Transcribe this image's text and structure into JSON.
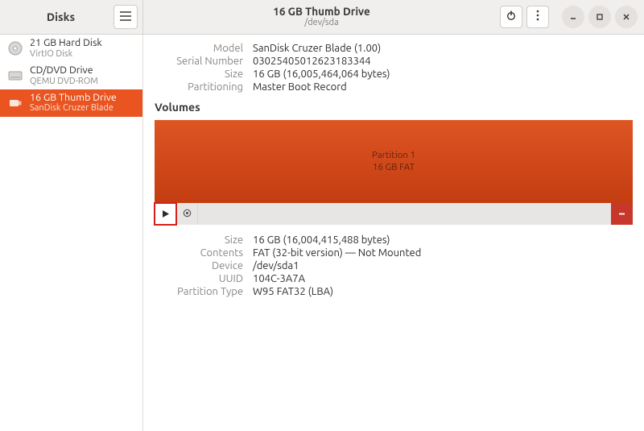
{
  "header": {
    "app_title": "Disks",
    "drive_title": "16 GB Thumb Drive",
    "drive_path": "/dev/sda"
  },
  "sidebar": {
    "drives": [
      {
        "name": "21 GB Hard Disk",
        "sub": "VirtIO Disk"
      },
      {
        "name": "CD/DVD Drive",
        "sub": "QEMU DVD-ROM"
      },
      {
        "name": "16 GB Thumb Drive",
        "sub": "SanDisk Cruzer Blade"
      }
    ]
  },
  "drive_info": {
    "labels": {
      "model": "Model",
      "serial": "Serial Number",
      "size": "Size",
      "partitioning": "Partitioning"
    },
    "model": "SanDisk Cruzer Blade (1.00)",
    "serial": "03025405012623183344",
    "size": "16 GB (16,005,464,064 bytes)",
    "partitioning": "Master Boot Record"
  },
  "volumes": {
    "section_title": "Volumes",
    "partition_title": "Partition 1",
    "partition_sub": "16 GB FAT"
  },
  "volume_info": {
    "labels": {
      "size": "Size",
      "contents": "Contents",
      "device": "Device",
      "uuid": "UUID",
      "ptype": "Partition Type"
    },
    "size": "16 GB (16,004,415,488 bytes)",
    "contents": "FAT (32-bit version) — Not Mounted",
    "device": "/dev/sda1",
    "uuid": "104C-3A7A",
    "ptype": "W95 FAT32 (LBA)"
  }
}
